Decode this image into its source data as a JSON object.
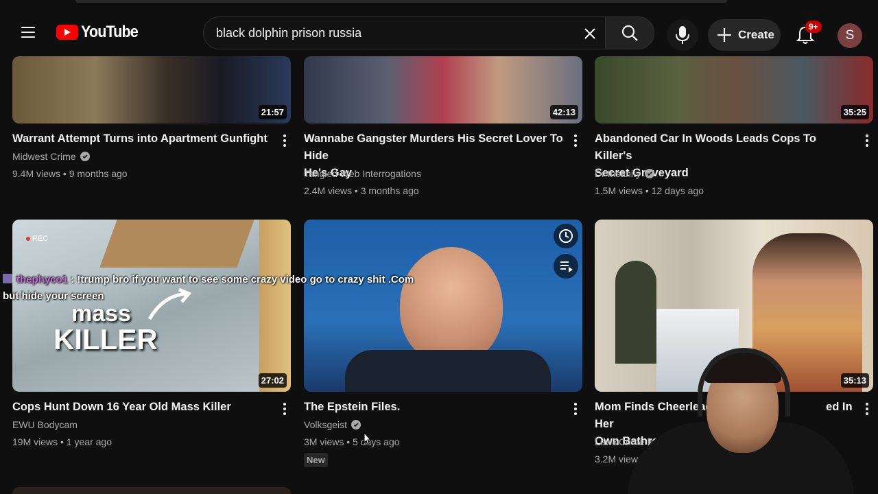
{
  "header": {
    "logo_text": "YouTube",
    "search_value": "black dolphin prison russia",
    "create_label": "Create",
    "notifications_badge": "9+",
    "avatar_letter": "S"
  },
  "videos": [
    {
      "title_line1": "Warrant Attempt Turns into Apartment Gunfight",
      "title_line2": "",
      "channel": "Midwest Crime",
      "verified": true,
      "views": "9.4M views",
      "age": "9 months ago",
      "duration": "21:57"
    },
    {
      "title_line1": "Wannabe Gangster Murders His Secret Lover To Hide",
      "title_line2": "He's Gay",
      "channel": "Tangled Web Interrogations",
      "verified": false,
      "views": "2.4M views",
      "age": "3 months ago",
      "duration": "42:13"
    },
    {
      "title_line1": "Abandoned Car In Woods Leads Cops To Killer's",
      "title_line2": "Secret Graveyard",
      "channel": "Dr Insanity",
      "verified": true,
      "views": "1.5M views",
      "age": "12 days ago",
      "duration": "35:25"
    },
    {
      "title_line1": "Cops Hunt Down 16 Year Old Mass Killer",
      "title_line2": "",
      "channel": "EWU Bodycam",
      "verified": false,
      "views": "19M views",
      "age": "1 year ago",
      "duration": "27:02",
      "thumb_text_1": "mass",
      "thumb_text_2": "KILLER",
      "thumb_rec": "REC"
    },
    {
      "title_line1": "The Epstein Files.",
      "title_line2": "",
      "channel": "Volksgeist",
      "verified": true,
      "views": "3M views",
      "age": "5 days ago",
      "badge": "New"
    },
    {
      "title_line1": "Mom Finds Cheerleader",
      "title_line1b": "ed In Her",
      "title_line2": "Own Bathroom",
      "channel": "Law&Crime Invest",
      "verified": false,
      "views": "3.2M views",
      "age": "",
      "duration": "35:13"
    }
  ],
  "chat": {
    "user": "thephyco1",
    "message": " : !trump bro if you want to see some crazy video go to crazy shit .Com",
    "message_line2": "but hide your screen"
  },
  "colors": {
    "background": "#0f0f0f",
    "brand_red": "#ff0000",
    "text_primary": "#f1f1f1",
    "text_secondary": "#aaaaaa"
  }
}
